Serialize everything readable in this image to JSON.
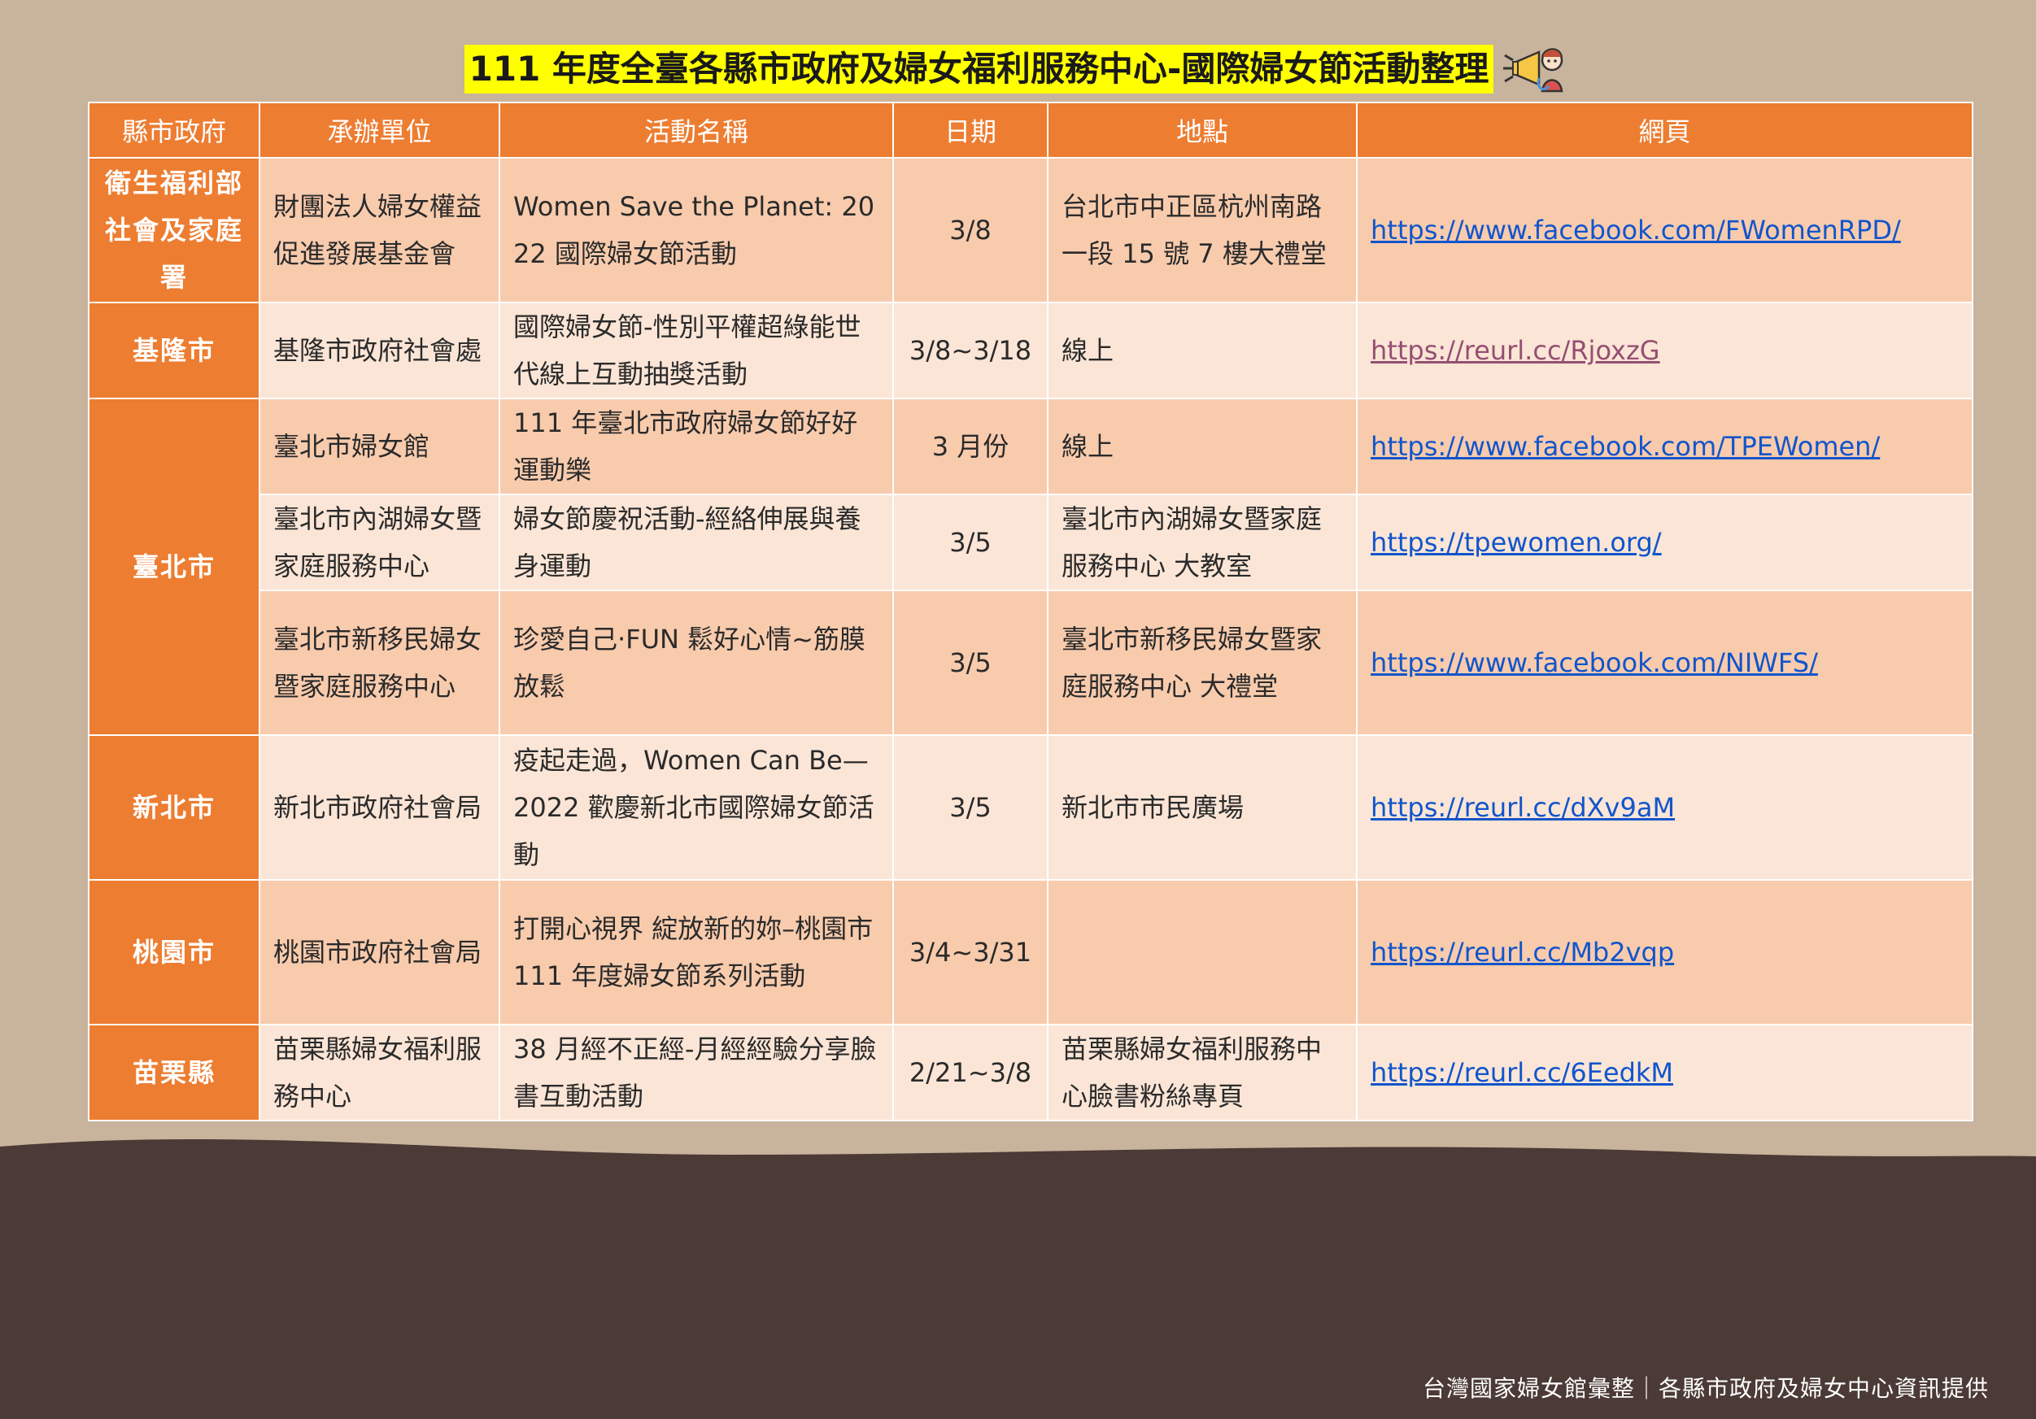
{
  "title": "111 年度全臺各縣市政府及婦女福利服務中心-國際婦女節活動整理",
  "headers": {
    "county": "縣市政府",
    "organizer": "承辦單位",
    "activity": "活動名稱",
    "date": "日期",
    "location": "地點",
    "website": "網頁"
  },
  "rows": [
    {
      "county": "衛生福利部社會及家庭署",
      "organizer": "財團法人婦女權益促進發展基金會",
      "activity": "Women Save the Planet: 2022 國際婦女節活動",
      "date": "3/8",
      "location": "台北市中正區杭州南路一段 15 號 7 樓大禮堂",
      "website": "https://www.facebook.com/FWomenRPD/"
    },
    {
      "county": "基隆市",
      "organizer": "基隆市政府社會處",
      "activity": "國際婦女節-性別平權超綠能世代線上互動抽獎活動",
      "date": "3/8~3/18",
      "location": "線上",
      "website": "https://reurl.cc/RjoxzG"
    },
    {
      "county": "臺北市",
      "organizer": "臺北市婦女館",
      "activity": "111 年臺北市政府婦女節好好運動樂",
      "date": "3 月份",
      "location": "線上",
      "website": "https://www.facebook.com/TPEWomen/"
    },
    {
      "county": "",
      "organizer": "臺北市內湖婦女暨家庭服務中心",
      "activity": "婦女節慶祝活動-經絡伸展與養身運動",
      "date": "3/5",
      "location": "臺北市內湖婦女暨家庭服務中心 大教室",
      "website": "https://tpewomen.org/"
    },
    {
      "county": "",
      "organizer": "臺北市新移民婦女暨家庭服務中心",
      "activity": "珍愛自己‧FUN 鬆好心情~筋膜放鬆",
      "date": "3/5",
      "location": "臺北市新移民婦女暨家庭服務中心 大禮堂",
      "website": "https://www.facebook.com/NIWFS/"
    },
    {
      "county": "新北市",
      "organizer": "新北市政府社會局",
      "activity": "疫起走過，Women Can Be—2022 歡慶新北市國際婦女節活動",
      "date": "3/5",
      "location": "新北市市民廣場",
      "website": "https://reurl.cc/dXv9aM"
    },
    {
      "county": "桃園市",
      "organizer": "桃園市政府社會局",
      "activity": "打開心視界 綻放新的妳–桃園市 111 年度婦女節系列活動",
      "date": "3/4~3/31",
      "location": "",
      "website": "https://reurl.cc/Mb2vqp"
    },
    {
      "county": "苗栗縣",
      "organizer": "苗栗縣婦女福利服務中心",
      "activity": "38 月經不正經-月經經驗分享臉書互動活動",
      "date": "2/21~3/8",
      "location": "苗栗縣婦女福利服務中心臉書粉絲專頁",
      "website": "https://reurl.cc/6EedkM"
    }
  ],
  "footer": "台灣國家婦女館彙整｜各縣市政府及婦女中心資訊提供",
  "icons": {
    "title_icon": "megaphone-character-icon"
  },
  "colors": {
    "header": "#ed7d31",
    "row_dark": "#f8cbad",
    "row_light": "#fbe5d6",
    "background": "#c8b39c",
    "ground": "#4b3a36",
    "title_highlight": "#ffff00"
  }
}
